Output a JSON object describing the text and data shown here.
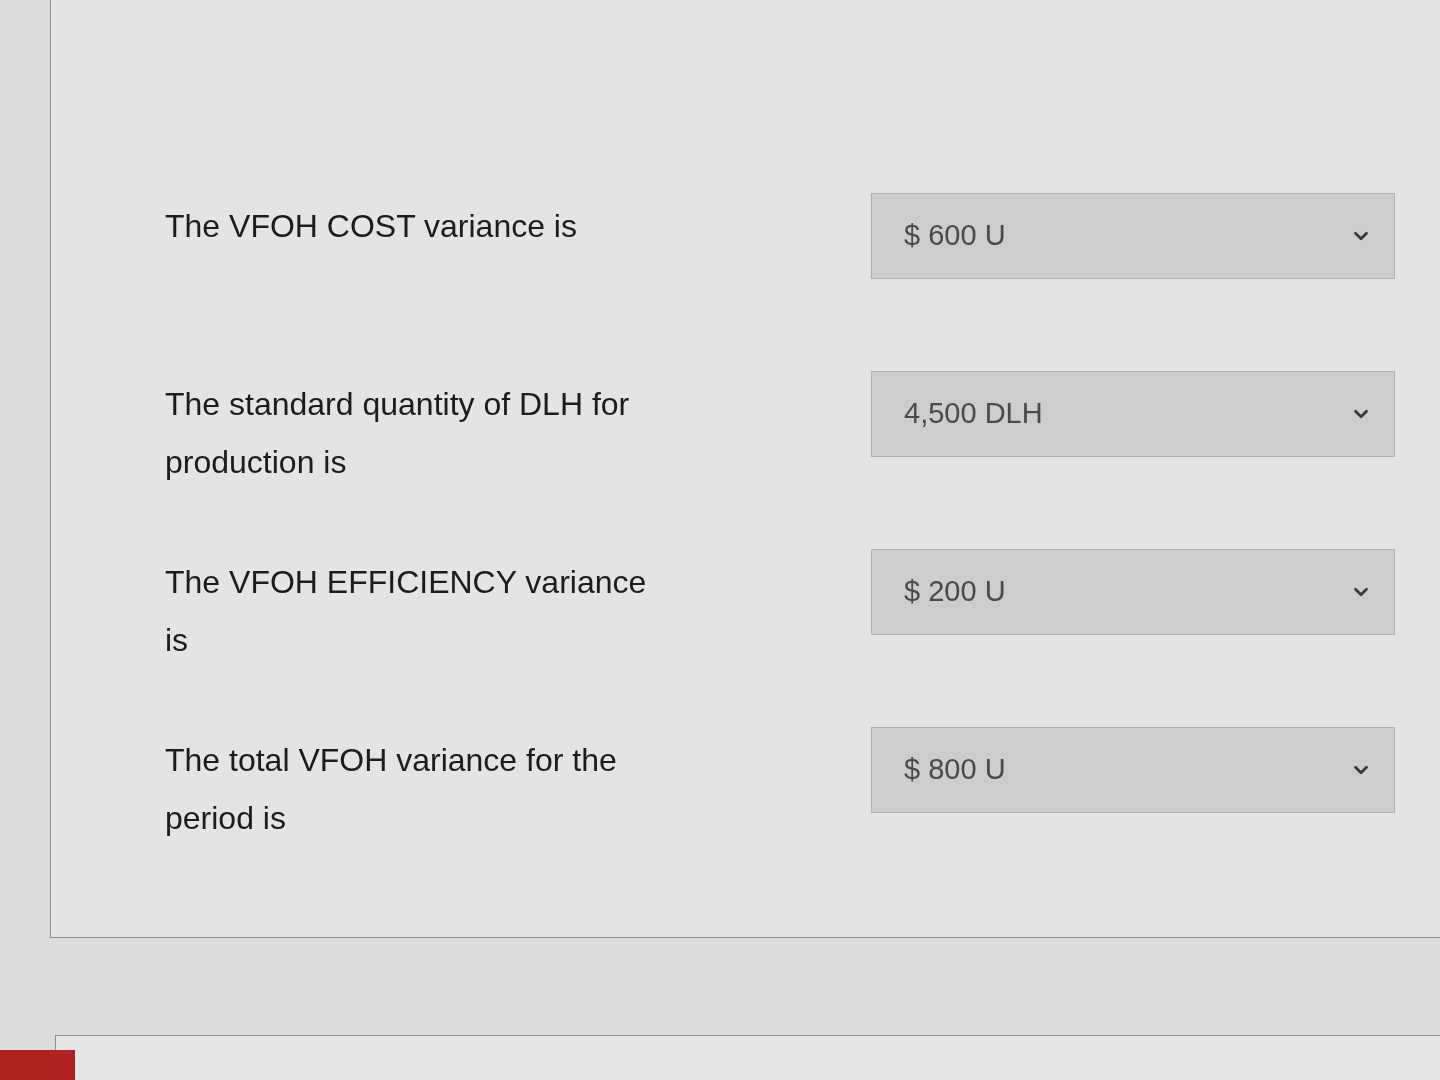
{
  "questions": [
    {
      "prompt": "The VFOH COST variance is",
      "answer": "$ 600 U"
    },
    {
      "prompt": "The standard quantity of DLH for production is",
      "answer": "4,500 DLH"
    },
    {
      "prompt": "The VFOH EFFICIENCY variance is",
      "answer": "$ 200 U"
    },
    {
      "prompt": "The total VFOH variance for the period is",
      "answer": "$ 800 U"
    }
  ]
}
